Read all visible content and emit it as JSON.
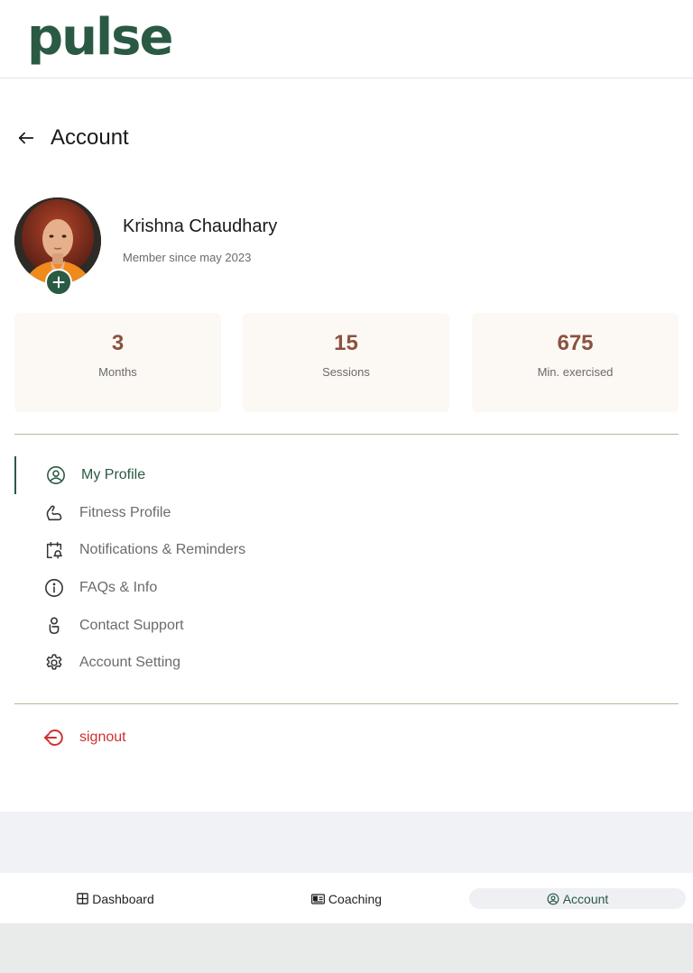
{
  "app": {
    "logo": "pulse"
  },
  "page": {
    "title": "Account"
  },
  "user": {
    "name": "Krishna Chaudhary",
    "member_since": "Member since may 2023"
  },
  "stats": [
    {
      "value": "3",
      "label": "Months"
    },
    {
      "value": "15",
      "label": "Sessions"
    },
    {
      "value": "675",
      "label": "Min. exercised"
    }
  ],
  "menu": [
    {
      "label": "My Profile",
      "icon": "user-circle-icon",
      "active": true
    },
    {
      "label": "Fitness Profile",
      "icon": "muscle-icon"
    },
    {
      "label": "Notifications & Reminders",
      "icon": "calendar-bell-icon"
    },
    {
      "label": "FAQs & Info",
      "icon": "info-icon"
    },
    {
      "label": "Contact Support",
      "icon": "support-icon"
    },
    {
      "label": "Account Setting",
      "icon": "gear-icon"
    }
  ],
  "signout": {
    "label": "signout",
    "icon": "signout-icon"
  },
  "bottom_nav": [
    {
      "label": "Dashboard",
      "icon": "grid-icon"
    },
    {
      "label": "Coaching",
      "icon": "id-card-icon"
    },
    {
      "label": "Account",
      "icon": "user-circle-icon",
      "active": true
    }
  ],
  "colors": {
    "brand": "#2a5a44",
    "stat_value": "#8a5240",
    "signout": "#d32f2f",
    "card_bg": "#fcf8f3"
  }
}
